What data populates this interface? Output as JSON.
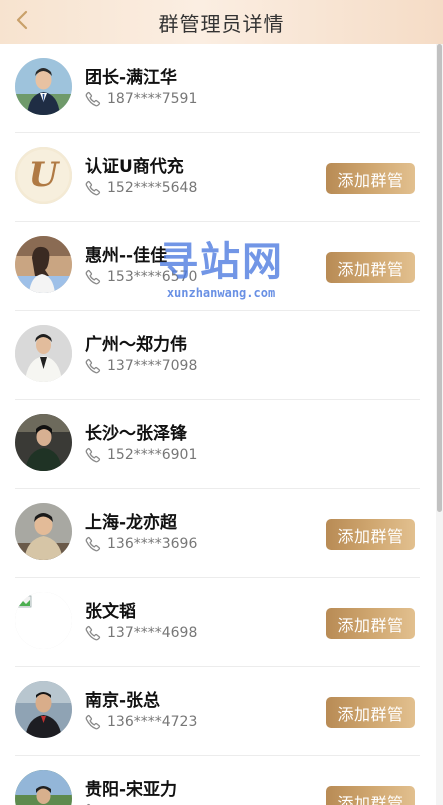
{
  "header": {
    "title": "群管理员详情",
    "back_icon": "chevron-left-icon"
  },
  "add_button_label": "添加群管",
  "phone_icon": "phone-icon",
  "members": [
    {
      "name": "团长-满江华",
      "phone": "187****7591",
      "has_add": false,
      "avatar": "person-suit-blue"
    },
    {
      "name": "认证U商代充",
      "phone": "152****5648",
      "has_add": true,
      "avatar": "letter-u-logo"
    },
    {
      "name": "惠州--佳佳",
      "phone": "153****6570",
      "has_add": true,
      "avatar": "person-woman"
    },
    {
      "name": "广州～郑力伟",
      "phone": "137****7098",
      "has_add": false,
      "avatar": "person-white-suit"
    },
    {
      "name": "长沙～张泽锋",
      "phone": "152****6901",
      "has_add": false,
      "avatar": "person-dark"
    },
    {
      "name": "上海-龙亦超",
      "phone": "136****3696",
      "has_add": true,
      "avatar": "person-beige"
    },
    {
      "name": "张文韬",
      "phone": "137****4698",
      "has_add": true,
      "avatar": "broken-image"
    },
    {
      "name": "南京-张总",
      "phone": "136****4723",
      "has_add": true,
      "avatar": "person-dark-jacket"
    },
    {
      "name": "贵阳-宋亚力",
      "phone": "",
      "has_add": true,
      "avatar": "person-outdoor"
    }
  ],
  "watermark": {
    "text": "寻站网",
    "url": "xunzhanwang.com"
  },
  "colors": {
    "header_bg": "#f7e3cf",
    "button_gold": "#c9a06a",
    "name_text": "#111111",
    "phone_text": "#777777",
    "watermark_blue": "#4f7de0"
  }
}
